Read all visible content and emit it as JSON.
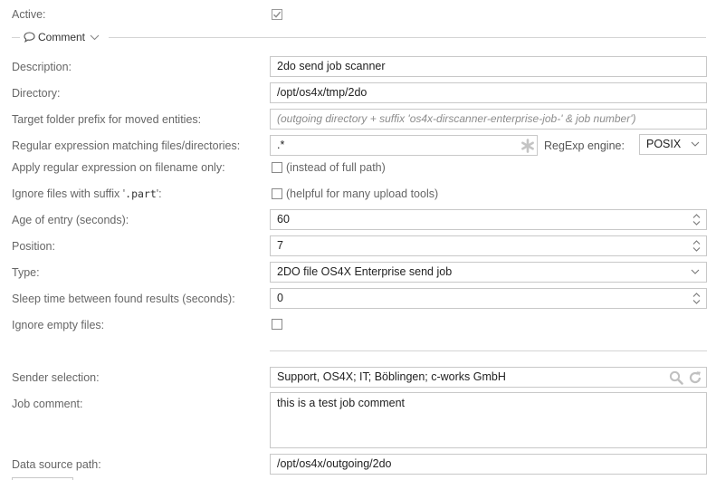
{
  "active": {
    "label": "Active:",
    "checked": true
  },
  "comment_section": {
    "label": "Comment",
    "icon": "speech-bubble-icon",
    "toggle_icon": "chevron-down-icon"
  },
  "description": {
    "label": "Description:",
    "value": "2do send job scanner"
  },
  "directory": {
    "label": "Directory:",
    "value": "/opt/os4x/tmp/2do"
  },
  "target_prefix": {
    "label": "Target folder prefix for moved entities:",
    "placeholder": "(outgoing directory + suffix 'os4x-dirscanner-enterprise-job-' & job number')"
  },
  "regex": {
    "label": "Regular expression matching files/directories:",
    "value": ".*",
    "required_icon": "asterisk-icon"
  },
  "regex_engine": {
    "label": "RegExp engine:",
    "value": "POSIX"
  },
  "apply_filename": {
    "label": "Apply regular expression on filename only:",
    "checked": false,
    "hint": "(instead of full path)"
  },
  "ignore_part": {
    "label_prefix": "Ignore files with suffix '",
    "label_code": ".part",
    "label_suffix": "':",
    "checked": false,
    "hint": "(helpful for many upload tools)"
  },
  "age": {
    "label": "Age of entry (seconds):",
    "value": "60"
  },
  "position": {
    "label": "Position:",
    "value": "7"
  },
  "type": {
    "label": "Type:",
    "value": "2DO file OS4X Enterprise send job"
  },
  "sleep": {
    "label": "Sleep time between found results (seconds):",
    "value": "0"
  },
  "ignore_empty": {
    "label": "Ignore empty files:",
    "checked": false
  },
  "sender": {
    "label": "Sender selection:",
    "value": "Support, OS4X; IT; Böblingen; c-works GmbH",
    "search_icon": "magnifier-icon",
    "reload_icon": "refresh-icon"
  },
  "job_comment": {
    "label": "Job comment:",
    "value": "this is a test job comment"
  },
  "data_source": {
    "label": "Data source path:",
    "value": "/opt/os4x/outgoing/2do"
  },
  "colors": {
    "border": "#c8c8c8",
    "label": "#666666",
    "text": "#222222",
    "placeholder": "#8c8c8c",
    "separator": "#d4d4d4"
  }
}
